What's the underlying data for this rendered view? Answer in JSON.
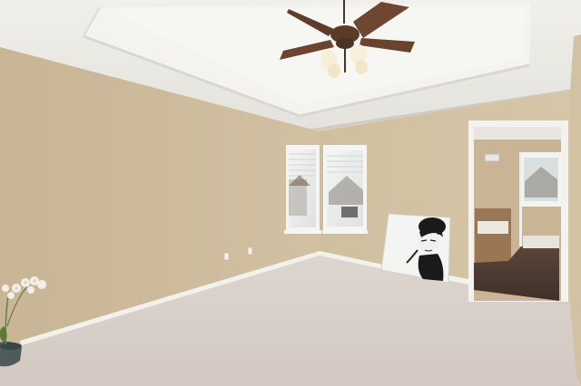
{
  "scene": {
    "description_alt": "",
    "palette": {
      "wall": "#cdbb9c",
      "wall_shadow": "#bfae90",
      "right_wall": "#d3c4a6",
      "ceiling": "#ecebe7",
      "tray": "#f3f2ee",
      "carpet": "#d9d0c9",
      "baseboard": "#f4f2ee",
      "window_frame": "#f6f6f4",
      "door_frame": "#f5f4f0",
      "fan_blade": "#6b4430",
      "fan_metal": "#5a3b29",
      "fan_light": "#f5ecd6",
      "floor_dark": "#4c3a2f",
      "tub": "#8a6a4e"
    },
    "objects": [
      "ceiling-fan",
      "tray-ceiling",
      "window-left",
      "window-right",
      "doorway-bathroom",
      "portrait-canvas",
      "orchid-plant",
      "carpet-floor"
    ]
  }
}
